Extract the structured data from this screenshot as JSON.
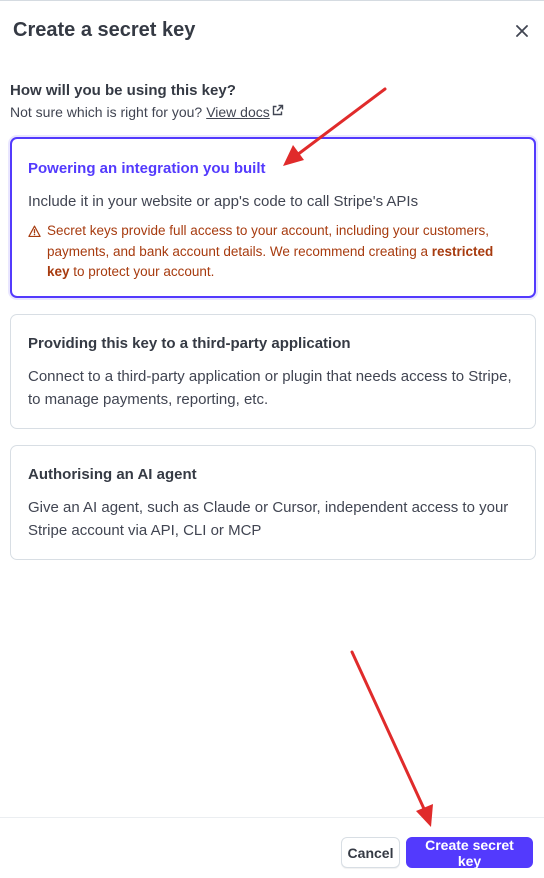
{
  "dialog": {
    "title": "Create a secret key",
    "close_icon": "close-icon"
  },
  "intro": {
    "question": "How will you be using this key?",
    "help_text": "Not sure which is right for you?",
    "docs_link": "View docs",
    "docs_icon": "external-link-icon"
  },
  "options": [
    {
      "title": "Powering an integration you built",
      "description": "Include it in your website or app's code to call Stripe's APIs",
      "selected": true,
      "warning": {
        "icon": "warning-icon",
        "text_before": "Secret keys provide full access to your account, including your customers, payments, and bank account details. We recommend creating a ",
        "bold": "restricted key",
        "text_after": " to protect your account."
      }
    },
    {
      "title": "Providing this key to a third-party application",
      "description": "Connect to a third-party application or plugin that needs access to Stripe, to manage payments, reporting, etc.",
      "selected": false
    },
    {
      "title": "Authorising an AI agent",
      "description": "Give an AI agent, such as Claude or Cursor, independent access to your Stripe account via API, CLI or MCP",
      "selected": false
    }
  ],
  "footer": {
    "cancel_label": "Cancel",
    "create_label": "Create secret key"
  },
  "colors": {
    "accent": "#533afd",
    "warning": "#a73b0f",
    "annotation_arrow": "#e02b2b"
  }
}
